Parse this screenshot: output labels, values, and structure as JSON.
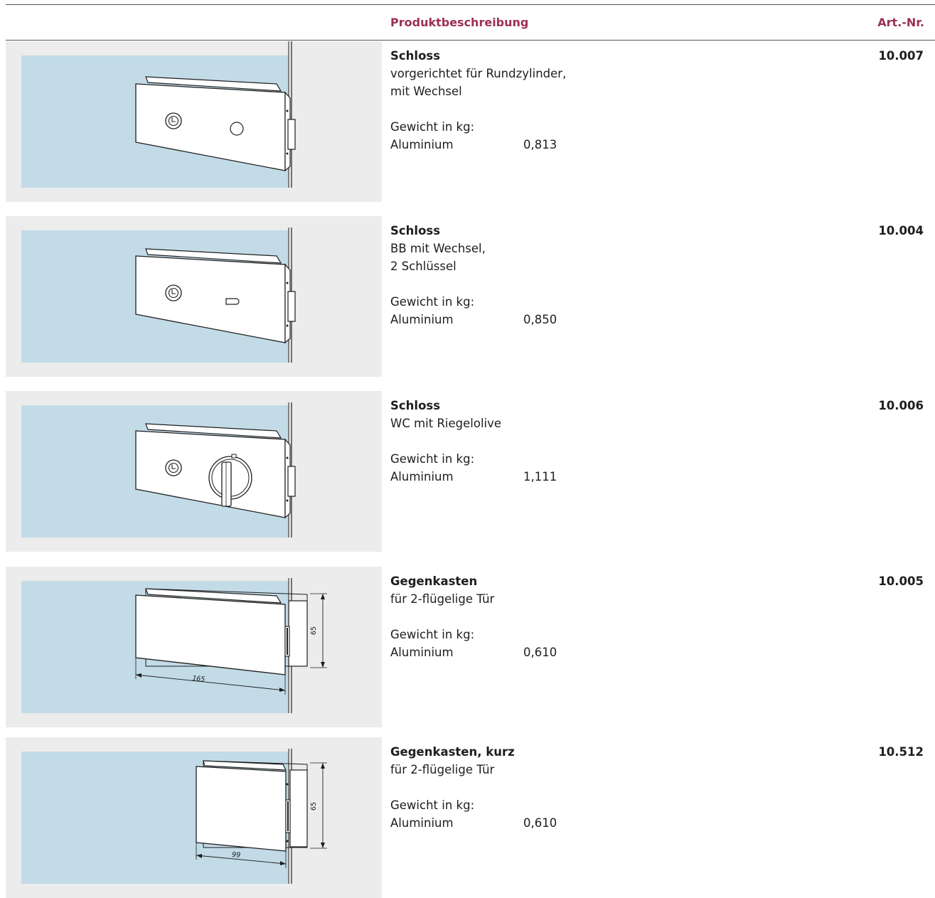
{
  "header": {
    "description_label": "Produktbeschreibung",
    "article_label": "Art.-Nr."
  },
  "products": [
    {
      "name": "Schloss",
      "lines": [
        "vorgerichtet für Rundzylinder,",
        "mit Wechsel"
      ],
      "weight_label": "Gewicht in kg:",
      "material": "Aluminium",
      "weight": "0,813",
      "article_no": "10.007"
    },
    {
      "name": "Schloss",
      "lines": [
        "BB mit Wechsel,",
        "2 Schlüssel"
      ],
      "weight_label": "Gewicht in kg:",
      "material": "Aluminium",
      "weight": "0,850",
      "article_no": "10.004"
    },
    {
      "name": "Schloss",
      "lines": [
        "WC mit Riegelolive"
      ],
      "weight_label": "Gewicht in kg:",
      "material": "Aluminium",
      "weight": "1,111",
      "article_no": "10.006"
    },
    {
      "name": "Gegenkasten",
      "lines": [
        "für 2-flügelige Tür"
      ],
      "weight_label": "Gewicht in kg:",
      "material": "Aluminium",
      "weight": "0,610",
      "article_no": "10.005",
      "dim_width": "165",
      "dim_height": "65"
    },
    {
      "name": "Gegenkasten, kurz",
      "lines": [
        "für 2-flügelige Tür"
      ],
      "weight_label": "Gewicht in kg:",
      "material": "Aluminium",
      "weight": "0,610",
      "article_no": "10.512",
      "dim_width": "99",
      "dim_height": "65"
    }
  ],
  "colors": {
    "accent": "#9c2f55",
    "glass": "#c2dbe7",
    "panel": "#ececec",
    "line": "#1e1e1e"
  }
}
